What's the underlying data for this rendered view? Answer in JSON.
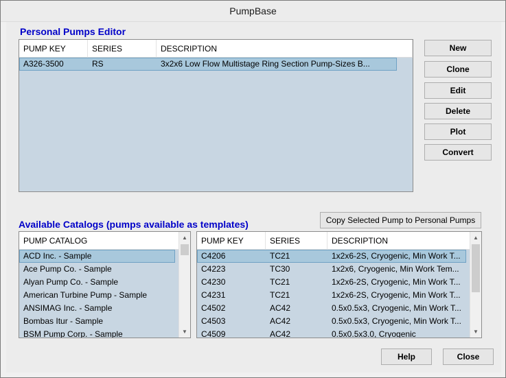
{
  "window": {
    "title": "PumpBase"
  },
  "personal": {
    "title": "Personal Pumps Editor",
    "columns": [
      "PUMP KEY",
      "SERIES",
      "DESCRIPTION"
    ],
    "rows": [
      {
        "key": "A326-3500",
        "series": "RS",
        "description": "3x2x6 Low Flow Multistage Ring Section Pump-Sizes B..."
      }
    ]
  },
  "actions": {
    "new": "New",
    "clone": "Clone",
    "edit": "Edit",
    "delete": "Delete",
    "plot": "Plot",
    "convert": "Convert"
  },
  "catalogs": {
    "title": "Available Catalogs (pumps available as templates)",
    "copy_button": "Copy Selected Pump to Personal Pumps",
    "catalog_column": "PUMP CATALOG",
    "catalog_items": [
      "ACD Inc. - Sample",
      "Ace Pump Co. - Sample",
      "Alyan Pump Co. - Sample",
      "American Turbine Pump - Sample",
      "ANSIMAG Inc. - Sample",
      "Bombas Itur - Sample",
      "BSM Pump Corp. - Sample"
    ],
    "pump_columns": [
      "PUMP KEY",
      "SERIES",
      "DESCRIPTION"
    ],
    "pump_rows": [
      {
        "key": "C4206",
        "series": "TC21",
        "description": "1x2x6-2S, Cryogenic, Min Work T..."
      },
      {
        "key": "C4223",
        "series": "TC30",
        "description": "1x2x6, Cryogenic, Min Work Tem..."
      },
      {
        "key": "C4230",
        "series": "TC21",
        "description": "1x2x6-2S, Cryogenic, Min Work T..."
      },
      {
        "key": "C4231",
        "series": "TC21",
        "description": "1x2x6-2S, Cryogenic, Min Work T..."
      },
      {
        "key": "C4502",
        "series": "AC42",
        "description": "0.5x0.5x3, Cryogenic, Min Work T..."
      },
      {
        "key": "C4503",
        "series": "AC42",
        "description": "0.5x0.5x3, Cryogenic, Min Work T..."
      },
      {
        "key": "C4509",
        "series": "AC42",
        "description": "0.5x0.5x3.0, Cryogenic"
      }
    ]
  },
  "footer": {
    "help": "Help",
    "close": "Close"
  }
}
